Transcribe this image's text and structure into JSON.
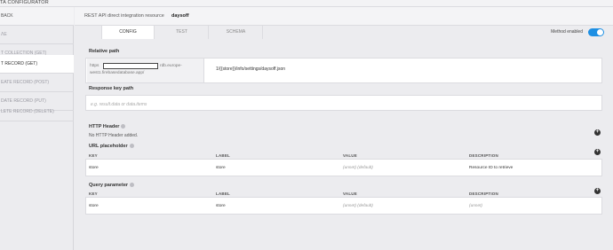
{
  "app": {
    "title": "TA CONFIGURATOR"
  },
  "sidebar": {
    "back_label": "BACK",
    "items": [
      {
        "label": "ΛE"
      },
      {
        "label": "T COLLECTION (GET)"
      },
      {
        "label": "T RECORD (GET)"
      },
      {
        "label": "EATE RECORD (POST)"
      },
      {
        "label": "DATE RECORD (PUT)"
      },
      {
        "label": "LETE RECORD (DELETE)"
      }
    ]
  },
  "header": {
    "label": "REST API direct integration resource",
    "value": "daysoff"
  },
  "tabs": [
    {
      "label": "CONFIG"
    },
    {
      "label": "TEST"
    },
    {
      "label": "SCHEMA"
    }
  ],
  "method_toggle": {
    "label": "Method enabled",
    "color": "#1d8fe3"
  },
  "relative_path": {
    "label": "Relative path",
    "prefix_start": "https",
    "prefix_mid": "rdb.europe-",
    "prefix_end": "west1.firebasedatabase.app/",
    "path": "1/{{store}}/info/settings/daysoff.json"
  },
  "response_key_path": {
    "label": "Response key path",
    "placeholder": "e.g. result.data or data.items"
  },
  "http_header": {
    "label": "HTTP Header",
    "empty_text": "No HTTP Header added."
  },
  "url_placeholder": {
    "label": "URL placeholder",
    "columns": [
      "KEY",
      "LABEL",
      "VALUE",
      "DESCRIPTION"
    ],
    "rows": [
      {
        "key": "store",
        "label": "store",
        "value": "(unset) (default)",
        "description": "Resource ID to retrieve"
      }
    ]
  },
  "query_parameter": {
    "label": "Query parameter",
    "columns": [
      "KEY",
      "LABEL",
      "VALUE",
      "DESCRIPTION"
    ],
    "rows": [
      {
        "key": "store",
        "label": "store",
        "value": "(unset) (default)",
        "description": "(unset)"
      }
    ]
  }
}
